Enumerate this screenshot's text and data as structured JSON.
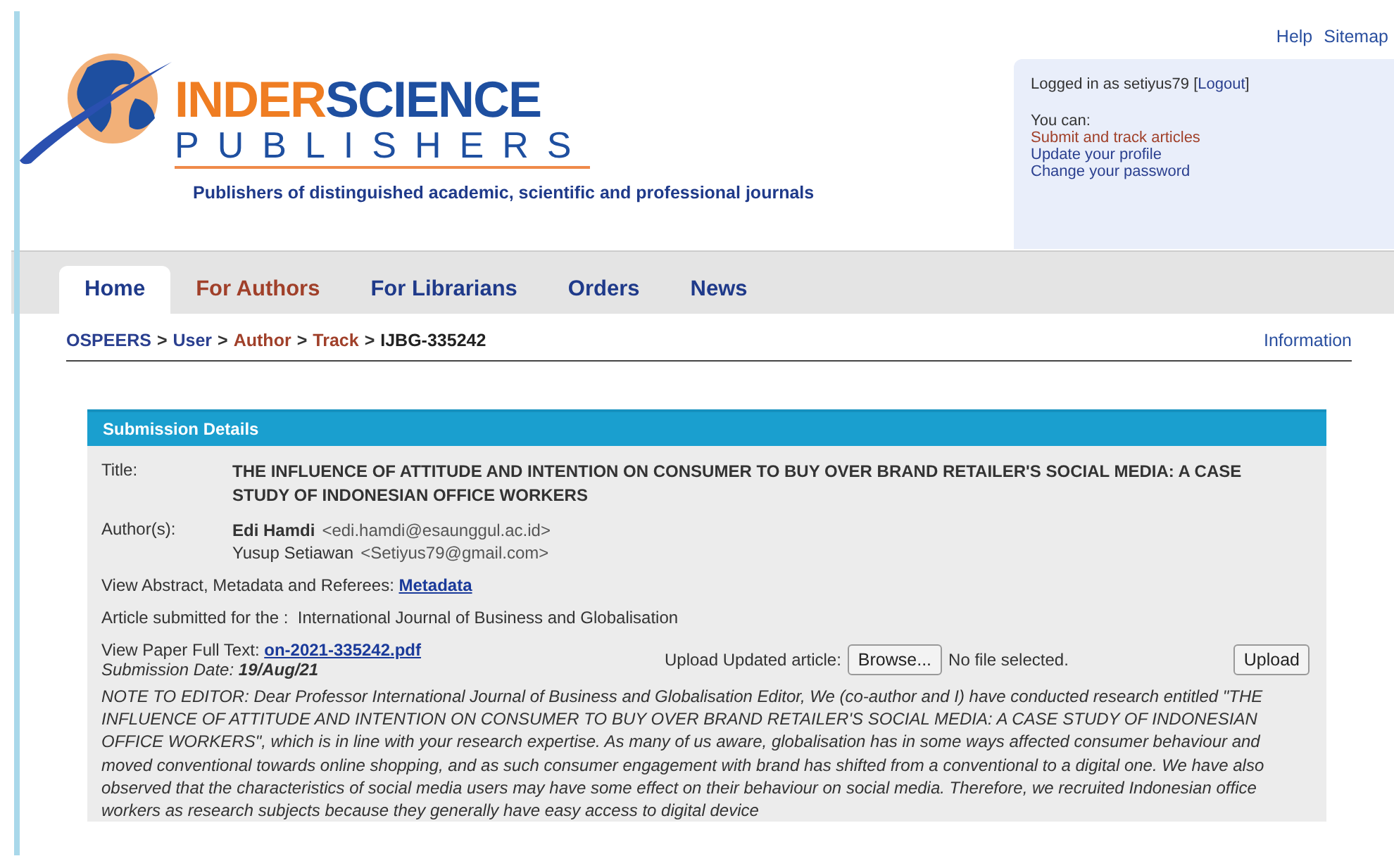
{
  "logo": {
    "brand_part1": "INDER",
    "brand_part2": "SCIENCE",
    "subtitle": "PUBLISHERS",
    "tagline": "Publishers of distinguished academic, scientific and professional journals"
  },
  "top_links": [
    "Help",
    "Sitemap"
  ],
  "user_box": {
    "logged_in_prefix": "Logged in as setiyus79 [",
    "logout": "Logout",
    "logged_in_suffix": "]",
    "you_can": "You can:",
    "links": [
      {
        "label": "Submit and track articles",
        "color": "#a0402a"
      },
      {
        "label": "Update your profile",
        "color": "#2a3f8f"
      },
      {
        "label": "Change your password",
        "color": "#2a3f8f"
      }
    ]
  },
  "tabs": [
    {
      "label": "Home",
      "selected": true,
      "color": "#1f3a8a"
    },
    {
      "label": "For Authors",
      "selected": false,
      "color": "#a0402a"
    },
    {
      "label": "For Librarians",
      "selected": false,
      "color": "#1f3a8a"
    },
    {
      "label": "Orders",
      "selected": false,
      "color": "#1f3a8a"
    },
    {
      "label": "News",
      "selected": false,
      "color": "#1f3a8a"
    }
  ],
  "breadcrumb": [
    {
      "label": "OSPEERS",
      "color": "#2a3f8f"
    },
    {
      "label": "User",
      "color": "#2a3f8f"
    },
    {
      "label": "Author",
      "color": "#a0402a"
    },
    {
      "label": "Track",
      "color": "#a0402a"
    },
    {
      "label": "IJBG-335242",
      "color": "#222222"
    }
  ],
  "breadcrumb_separator": ">",
  "information_link": "Information",
  "panel": {
    "title": "Submission Details",
    "title_label": "Title:",
    "article_title": "THE INFLUENCE OF ATTITUDE AND INTENTION ON CONSUMER TO BUY OVER BRAND RETAILER'S SOCIAL MEDIA: A CASE STUDY OF INDONESIAN OFFICE WORKERS",
    "authors_label": "Author(s):",
    "authors": [
      {
        "name": "Edi Hamdi",
        "email": "<edi.hamdi@esaunggul.ac.id>",
        "bold": true
      },
      {
        "name": "Yusup Setiawan",
        "email": "<Setiyus79@gmail.com>",
        "bold": false
      }
    ],
    "metadata_label": "View Abstract, Metadata and Referees:",
    "metadata_link": "Metadata",
    "submitted_for": "Article submitted for the :  International Journal of Business and Globalisation",
    "full_text_label": "View Paper Full Text:",
    "full_text_link": "on-2021-335242.pdf",
    "submission_date_label": "Submission Date:",
    "submission_date": "19/Aug/21",
    "upload_label": "Upload Updated article:",
    "browse_button": "Browse...",
    "file_status": "No file selected.",
    "upload_button": "Upload",
    "note": "NOTE TO EDITOR: Dear Professor International Journal of Business and Globalisation Editor, We (co-author and I) have conducted research entitled \"THE INFLUENCE OF ATTITUDE AND INTENTION ON CONSUMER TO BUY OVER BRAND RETAILER'S SOCIAL MEDIA: A CASE STUDY OF INDONESIAN OFFICE WORKERS\", which is in line with your research expertise. As many of us aware, globalisation has in some ways affected consumer behaviour and moved conventional towards online shopping, and as such consumer engagement with brand has shifted from a conventional to a digital one. We have also observed that the characteristics of social media users may have some effect on their behaviour on social media. Therefore, we recruited Indonesian office workers as research subjects because they generally have easy access to digital device"
  }
}
